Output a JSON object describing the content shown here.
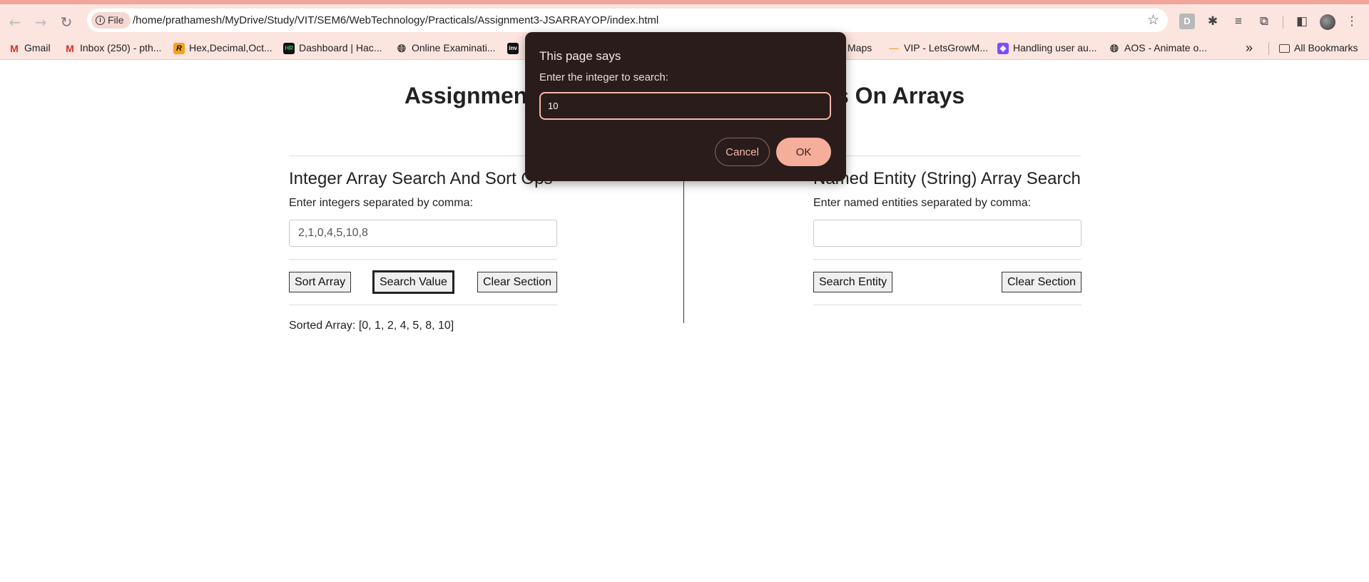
{
  "browser": {
    "file_chip": "File",
    "url": "/home/prathamesh/MyDrive/Study/VIT/SEM6/WebTechnology/Practicals/Assignment3-JSARRAYOP/index.html",
    "all_bookmarks": "All Bookmarks",
    "bookmarks": [
      "Gmail",
      "Inbox (250) - pth...",
      "Hex,Decimal,Oct...",
      "Dashboard | Hac...",
      "Online Examinati...",
      "Maps",
      "VIP - LetsGrowM...",
      "Handling user au...",
      "AOS - Animate o..."
    ],
    "colors": {
      "toolbar": "#fce4df",
      "accent": "#f0a79a"
    }
  },
  "page": {
    "title_left": "Assignment",
    "title_right": "s On Arrays",
    "integer_section": {
      "heading": "Integer Array Search And Sort Ops",
      "label": "Enter integers separated by comma:",
      "input_value": "2,1,0,4,5,10,8",
      "sort_label": "Sort Array",
      "search_label": "Search Value",
      "clear_label": "Clear Section",
      "result": "Sorted Array: [0, 1, 2, 4, 5, 8, 10]"
    },
    "string_section": {
      "heading": "Named Entity (String) Array Search",
      "label": "Enter named entities separated by comma:",
      "input_value": "",
      "search_label": "Search Entity",
      "clear_label": "Clear Section"
    }
  },
  "dialog": {
    "title": "This page says",
    "message": "Enter the integer to search:",
    "input_value": "10",
    "cancel_label": "Cancel",
    "ok_label": "OK",
    "colors": {
      "background": "#2a1c1a",
      "ok": "#f5ad9c",
      "border": "#f3b7a9"
    }
  }
}
